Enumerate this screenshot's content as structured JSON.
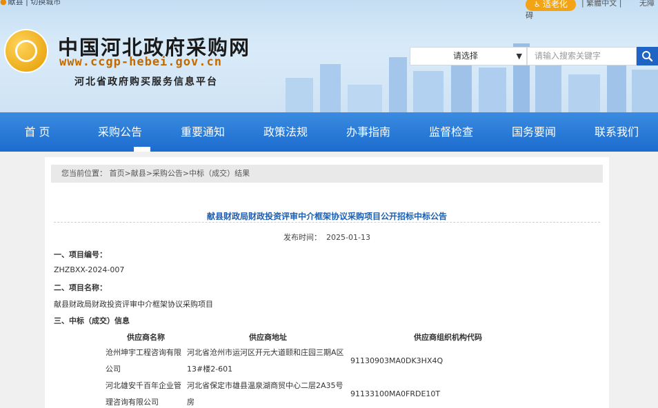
{
  "topbar": {
    "location_text": "献县 | 切换城市",
    "elder_label": "适老化",
    "traditional_label": "| 繁體中文 |",
    "barrier_top": "无障",
    "barrier_bottom": "碍"
  },
  "brand": {
    "title": "中国河北政府采购网",
    "url": "www.ccgp-hebei.gov.cn",
    "subtitle": "河北省政府购买服务信息平台"
  },
  "search": {
    "select_value": "请选择",
    "placeholder": "请输入搜索关键字"
  },
  "nav": {
    "items": [
      "首 页",
      "采购公告",
      "重要通知",
      "政策法规",
      "办事指南",
      "监督检查",
      "国务要闻",
      "联系我们"
    ],
    "active": "采购公告"
  },
  "breadcrumb": "您当前位置： 首页>献县>采购公告>中标（成交）结果",
  "doc": {
    "title": "献县财政局财政投资评审中介框架协议采购项目公开招标中标公告",
    "publish_label": "发布时间：",
    "publish_date": "2025-01-13",
    "s1_heading": "一、项目编号：",
    "s1_value": "ZHZBXX-2024-007",
    "s2_heading": "二、项目名称：",
    "s2_value": "献县财政局财政投资评审中介框架协议采购项目",
    "s3_heading": "三、中标（成交）信息",
    "table": {
      "headers": [
        "供应商名称",
        "供应商地址",
        "供应商组织机构代码"
      ],
      "rows": [
        {
          "name_l1": "沧州坤宇工程咨询有限",
          "name_l2": "公司",
          "addr_l1": "河北省沧州市运河区开元大道颐和庄园三期A区",
          "addr_l2": "13#楼2-601",
          "code": "91130903MA0DK3HX4Q"
        },
        {
          "name_l1": "河北雄安千百年企业管",
          "name_l2": "理咨询有限公司",
          "addr_l1": "河北省保定市雄县温泉湖商贸中心二层2A35号",
          "addr_l2": "房",
          "code": "91133100MA0FRDE10T"
        }
      ]
    }
  },
  "colors": {
    "nav_bg": "#1c6ccf",
    "title_blue": "#1c5fb0",
    "elder_orange": "#f2a416",
    "search_btn": "#1f63c4"
  },
  "icons": {
    "location": "location-pin-icon",
    "elder": "person-icon",
    "search": "search-icon",
    "select": "chevron-down-icon",
    "logo": "site-logo-emblem"
  }
}
